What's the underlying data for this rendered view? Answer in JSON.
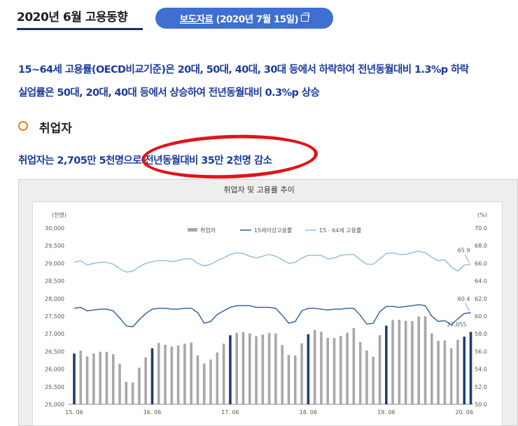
{
  "header": {
    "title": "2020년 6월 고용동향",
    "press_link": "보도자료",
    "press_date": "(2020년 7월 15일)"
  },
  "summary": {
    "line1": "15~64세 고용률(OECD비교기준)은 20대, 50대, 40대, 30대 등에서 하락하여 전년동월대비 1.3%p 하락",
    "line2": "실업률은 50대, 20대, 40대 등에서 상승하여 전년동월대비 0.3%p 상승"
  },
  "section": {
    "title": "취업자",
    "body": "취업자는 2,705만 5천명으로 전년동월대비 35만 2천명 감소"
  },
  "colors": {
    "bar": "#a8a8a8",
    "bar_highlight": "#1f3f6e",
    "line15": "#2a5c9c",
    "line1564": "#8ebde0",
    "accent": "#3f6fd1",
    "annotation": "#e0141b"
  },
  "chart_data": {
    "type": "bar",
    "title": "취업자 및 고용률 추이",
    "left_unit": "(천명)",
    "right_unit": "(%)",
    "ylim": [
      25000,
      30000
    ],
    "y2lim": [
      50.0,
      70.0
    ],
    "yticks": [
      "30,000",
      "29,500",
      "29,000",
      "28,500",
      "28,000",
      "27,500",
      "27,000",
      "26,500",
      "26,000",
      "25,500",
      "25,000"
    ],
    "y2ticks": [
      "70.0",
      "68.0",
      "66.0",
      "64.0",
      "62.0",
      "60.0",
      "58.0",
      "56.0",
      "54.0",
      "52.0",
      "50.0"
    ],
    "xticks": [
      "15. 06",
      "16. 06",
      "17. 06",
      "18. 06",
      "19. 06",
      "20. 06"
    ],
    "legend": [
      "취업자",
      "15세이상고용률",
      "15 - 64세 고용률"
    ],
    "annotations": [
      "65.9",
      "60.4",
      "27,055"
    ],
    "highlight_every": 12,
    "series": [
      {
        "name": "취업자",
        "values": [
          26440,
          26520,
          26360,
          26440,
          26490,
          26490,
          26420,
          26150,
          25640,
          25620,
          26040,
          26330,
          26590,
          26740,
          26690,
          26640,
          26670,
          26720,
          26750,
          26390,
          26160,
          26270,
          26470,
          26720,
          26960,
          27030,
          27050,
          27010,
          26930,
          26980,
          27020,
          27010,
          26680,
          26400,
          26380,
          26730,
          26990,
          27110,
          27060,
          26890,
          26880,
          26940,
          27030,
          27160,
          26770,
          26530,
          26350,
          26960,
          27230,
          27390,
          27400,
          27370,
          27360,
          27490,
          27500,
          27010,
          26800,
          26810,
          26590,
          26830,
          26920,
          27055
        ]
      },
      {
        "name": "15세이상고용률",
        "values": [
          60.9,
          61.0,
          60.6,
          60.7,
          60.8,
          60.8,
          60.6,
          59.8,
          58.9,
          58.8,
          59.6,
          60.3,
          60.8,
          60.9,
          60.9,
          60.8,
          60.8,
          60.9,
          60.9,
          60.4,
          59.2,
          59.4,
          60.2,
          60.6,
          61.0,
          61.2,
          61.2,
          61.2,
          61.0,
          61.0,
          61.0,
          60.9,
          60.1,
          59.2,
          59.4,
          60.6,
          60.9,
          60.9,
          60.8,
          60.7,
          60.8,
          60.8,
          60.9,
          60.9,
          60.1,
          59.1,
          59.2,
          60.5,
          61.1,
          61.1,
          61.0,
          61.1,
          61.2,
          61.3,
          61.2,
          60.0,
          59.4,
          59.5,
          59.0,
          59.7,
          60.3,
          60.4
        ]
      },
      {
        "name": "15 - 64세 고용률",
        "values": [
          66.1,
          66.3,
          65.8,
          66.0,
          66.1,
          66.1,
          65.9,
          65.4,
          65.0,
          65.1,
          65.6,
          66.0,
          66.2,
          66.3,
          66.3,
          66.2,
          66.3,
          66.5,
          66.5,
          66.0,
          65.7,
          65.9,
          66.3,
          66.6,
          67.0,
          67.2,
          67.1,
          66.8,
          66.6,
          66.8,
          67.0,
          66.8,
          66.4,
          66.0,
          66.1,
          66.6,
          66.9,
          66.9,
          66.9,
          66.5,
          66.6,
          66.9,
          67.0,
          67.0,
          66.4,
          65.9,
          65.9,
          66.5,
          67.1,
          67.2,
          67.0,
          67.0,
          67.2,
          67.4,
          67.2,
          66.7,
          66.3,
          66.4,
          65.6,
          65.1,
          65.8,
          65.9
        ]
      }
    ]
  }
}
